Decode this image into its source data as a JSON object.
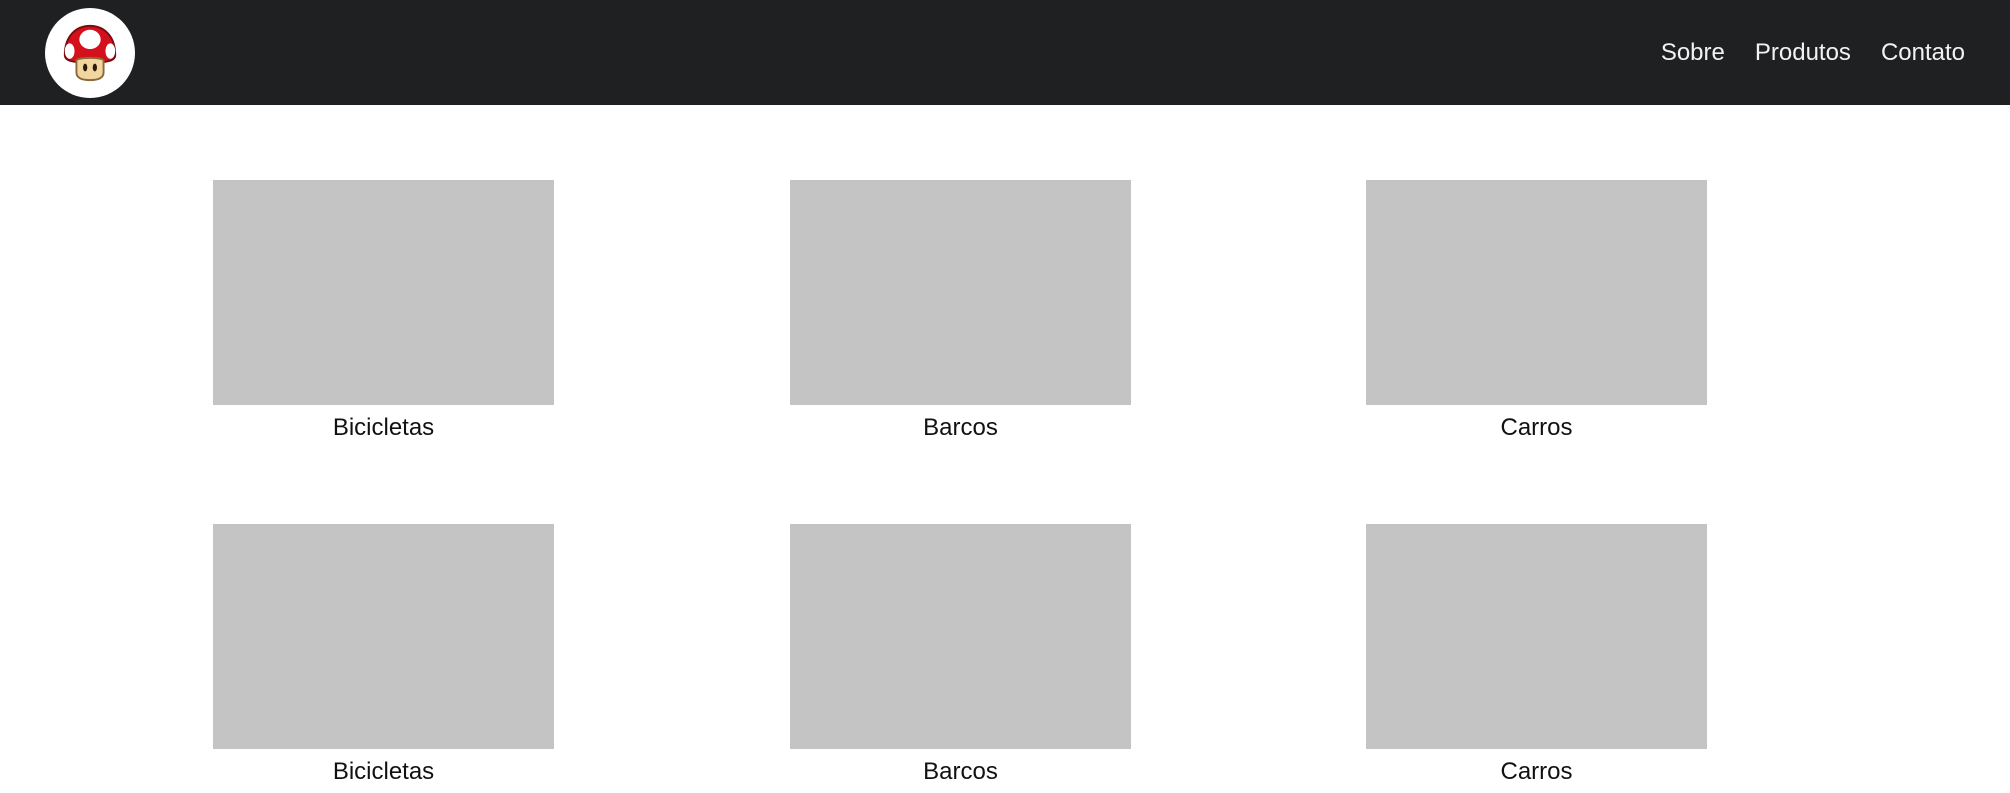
{
  "header": {
    "logo_icon": "mushroom-icon",
    "background": "#1f2022",
    "nav": [
      {
        "label": "Sobre"
      },
      {
        "label": "Produtos"
      },
      {
        "label": "Contato"
      }
    ]
  },
  "products": {
    "placeholder_color": "#c4c4c4",
    "rows": [
      {
        "items": [
          {
            "label": "Bicicletas"
          },
          {
            "label": "Barcos"
          },
          {
            "label": "Carros"
          }
        ]
      },
      {
        "items": [
          {
            "label": "Bicicletas"
          },
          {
            "label": "Barcos"
          },
          {
            "label": "Carros"
          }
        ]
      }
    ]
  }
}
